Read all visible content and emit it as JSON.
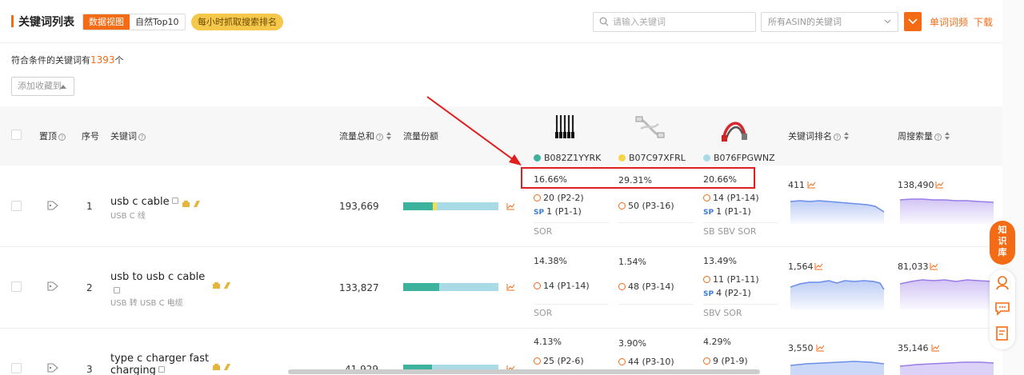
{
  "header": {
    "title": "关键词列表",
    "view_tabs": [
      "数据视图",
      "自然Top10"
    ],
    "hourly_badge": "每小时抓取搜索排名",
    "search_placeholder": "请输入关键词",
    "asin_select": "所有ASIN的关键词",
    "link_wordfreq": "单词词频",
    "link_download": "下载"
  },
  "summary": {
    "prefix": "符合条件的关键词有",
    "count": "1393",
    "suffix": "个"
  },
  "favorite_button": "添加收藏到",
  "columns": {
    "pin": "置顶",
    "index": "序号",
    "keyword": "关键词",
    "traffic_total": "流量总和",
    "traffic_share": "流量份额",
    "kw_rank": "关键词排名",
    "weekly_search": "周搜索量"
  },
  "products": [
    {
      "asin": "B082Z1YYRK",
      "color": "#3db39e"
    },
    {
      "asin": "B07C97XFRL",
      "color": "#f5d44a"
    },
    {
      "asin": "B076FPGWNZ",
      "color": "#a8dbe6"
    }
  ],
  "rows": [
    {
      "index": "1",
      "keyword": "usb c cable",
      "keyword_cn": "USB C 线",
      "traffic": "193,669",
      "share": [
        0.31,
        0.04
      ],
      "p1": {
        "pct": "16.66%",
        "organic": "20 (P2-2)",
        "sp": "1 (P1-1)",
        "tags": "SOR"
      },
      "p2": {
        "pct": "29.31%",
        "organic": "50 (P3-16)",
        "sp": "",
        "tags": ""
      },
      "p3": {
        "pct": "20.66%",
        "organic": "14 (P1-14)",
        "sp": "1 (P1-1)",
        "tags": "SB SBV SOR"
      },
      "kw_rank": "411",
      "weekly": "138,490"
    },
    {
      "index": "2",
      "keyword": "usb to usb c cable",
      "keyword_cn": "USB 转 USB C 电缆",
      "traffic": "133,827",
      "share": [
        0.38,
        0.0
      ],
      "p1": {
        "pct": "14.38%",
        "organic": "14 (P1-14)",
        "sp": "",
        "tags": "SOR"
      },
      "p2": {
        "pct": "1.54%",
        "organic": "48 (P3-14)",
        "sp": "",
        "tags": ""
      },
      "p3": {
        "pct": "13.49%",
        "organic": "11 (P1-11)",
        "sp": "4 (P2-1)",
        "tags": "SBV SOR"
      },
      "kw_rank": "1,564",
      "weekly": "81,033"
    },
    {
      "index": "3",
      "keyword": "type c charger fast",
      "keyword2": "charging",
      "keyword_cn": "",
      "traffic": "41,929",
      "share": [
        0.3,
        0.0
      ],
      "p1": {
        "pct": "4.13%",
        "organic": "25 (P2-6)",
        "sp": "",
        "tags": ""
      },
      "p2": {
        "pct": "3.90%",
        "organic": "44 (P3-10)",
        "sp": "",
        "tags": ""
      },
      "p3": {
        "pct": "4.29%",
        "organic": "9 (P1-9)",
        "sp": "",
        "tags": ""
      },
      "kw_rank": "3,550",
      "weekly": "35,146"
    }
  ],
  "sp_label": "SP",
  "float": {
    "kb": "知识库"
  },
  "colors": {
    "accent": "#f46b16",
    "highlight": "#e02020",
    "rank_spark": "#6b8ee8",
    "search_spark": "#9a7ce8"
  }
}
